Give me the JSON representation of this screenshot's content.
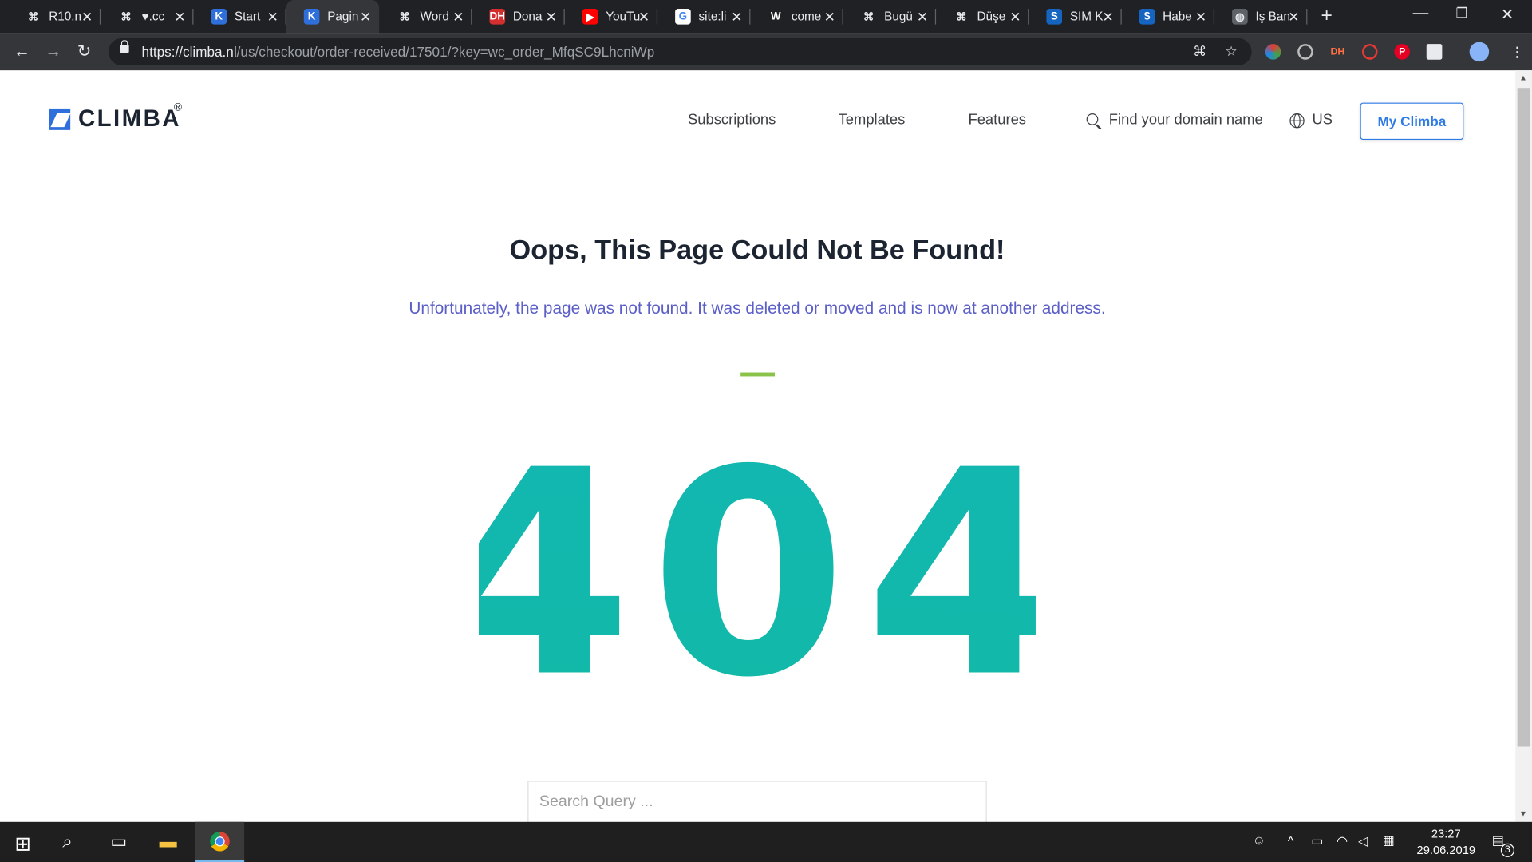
{
  "browser": {
    "tabs": [
      {
        "title": "R10.n",
        "icon": "binoculars-icon",
        "active": false
      },
      {
        "title": "♥.cc",
        "icon": "binoculars-icon",
        "active": false
      },
      {
        "title": "Start",
        "icon": "climba-icon",
        "active": false
      },
      {
        "title": "Pagin",
        "icon": "climba-icon",
        "active": true
      },
      {
        "title": "Word",
        "icon": "binoculars-icon",
        "active": false
      },
      {
        "title": "Dona",
        "icon": "dh-icon",
        "active": false
      },
      {
        "title": "YouTu",
        "icon": "youtube-icon",
        "active": false
      },
      {
        "title": "site:li",
        "icon": "google-icon",
        "active": false
      },
      {
        "title": "come",
        "icon": "w-icon",
        "active": false
      },
      {
        "title": "Bugü",
        "icon": "binoculars-icon",
        "active": false
      },
      {
        "title": "Düşe",
        "icon": "binoculars-icon",
        "active": false
      },
      {
        "title": "SIM K",
        "icon": "sim-icon",
        "active": false
      },
      {
        "title": "Habe",
        "icon": "dollar-icon",
        "active": false
      },
      {
        "title": "İş Ban",
        "icon": "globe-icon",
        "active": false
      }
    ],
    "url_host": "https://climba.nl",
    "url_path": "/us/checkout/order-received/17501/?key=wc_order_MfqSC9LhcniWp",
    "extension_labels": {
      "dh": "DH",
      "pinterest": "P"
    }
  },
  "site": {
    "logo_text": "CLIMBA",
    "logo_reg": "®",
    "nav": {
      "subscriptions": "Subscriptions",
      "templates": "Templates",
      "features": "Features",
      "domain_search": "Find your domain name",
      "region": "US",
      "account_button": "My Climba"
    }
  },
  "error_page": {
    "title": "Oops, This Page Could Not Be Found!",
    "message": "Unfortunately, the page was not found. It was deleted or moved and is now at another address.",
    "code": "404",
    "search_placeholder": "Search Query ...",
    "colors": {
      "accent_blue": "#2f7be5",
      "message": "#5b5fc7",
      "divider": "#8bc34a",
      "code_fill": "#1ab5a8"
    }
  },
  "taskbar": {
    "time": "23:27",
    "date": "29.06.2019",
    "notifications": "3"
  }
}
